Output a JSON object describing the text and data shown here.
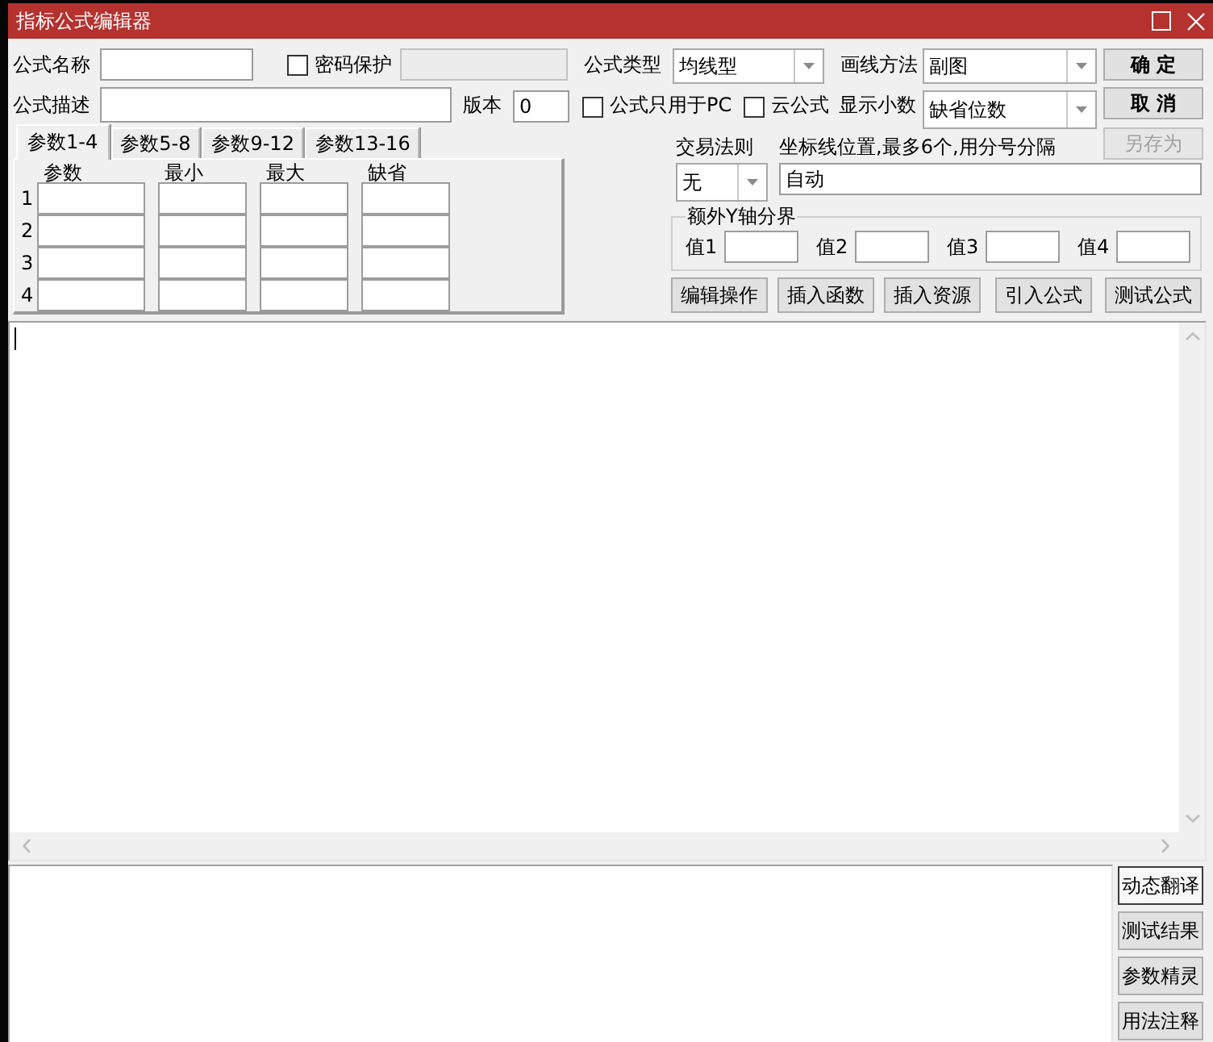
{
  "window": {
    "title": "指标公式编辑器"
  },
  "form": {
    "name": {
      "label": "公式名称"
    },
    "password": {
      "label": "密码保护",
      "checked": false
    },
    "password_field": {
      "disabled": true
    },
    "formula_type": {
      "label": "公式类型",
      "value": "均线型"
    },
    "draw_method": {
      "label": "画线方法",
      "value": "副图"
    },
    "description": {
      "label": "公式描述"
    },
    "version": {
      "label": "版本",
      "value": "0"
    },
    "options": [
      {
        "label": "公式只用于PC",
        "checked": false
      },
      {
        "label": "云公式",
        "checked": false
      }
    ],
    "decimals": {
      "label": "显示小数",
      "value": "缺省位数"
    }
  },
  "actions": [
    {
      "label": "确 定",
      "disabled": false
    },
    {
      "label": "取 消",
      "disabled": false
    },
    {
      "label": "另存为",
      "disabled": true
    }
  ],
  "param_tabs": [
    {
      "label": "参数1-4",
      "selected": true
    },
    {
      "label": "参数5-8",
      "selected": false
    },
    {
      "label": "参数9-12",
      "selected": false
    },
    {
      "label": "参数13-16",
      "selected": false
    }
  ],
  "param_table": {
    "columns": [
      "参数",
      "最小",
      "最大",
      "缺省"
    ],
    "rows": [
      "1",
      "2",
      "3",
      "4"
    ]
  },
  "trade_rule": {
    "label": "交易法则",
    "value": "无"
  },
  "axis_lines": {
    "label": "坐标线位置,最多6个,用分号分隔",
    "value": "自动"
  },
  "y_split": {
    "title": "额外Y轴分界",
    "fields": [
      "值1",
      "值2",
      "值3",
      "值4"
    ]
  },
  "tool_buttons": [
    "编辑操作",
    "插入函数",
    "插入资源",
    "引入公式",
    "测试公式"
  ],
  "side_buttons": [
    {
      "label": "动态翻译",
      "focused": true
    },
    {
      "label": "测试结果",
      "focused": false
    },
    {
      "label": "参数精灵",
      "focused": false
    },
    {
      "label": "用法注释",
      "focused": false
    }
  ]
}
